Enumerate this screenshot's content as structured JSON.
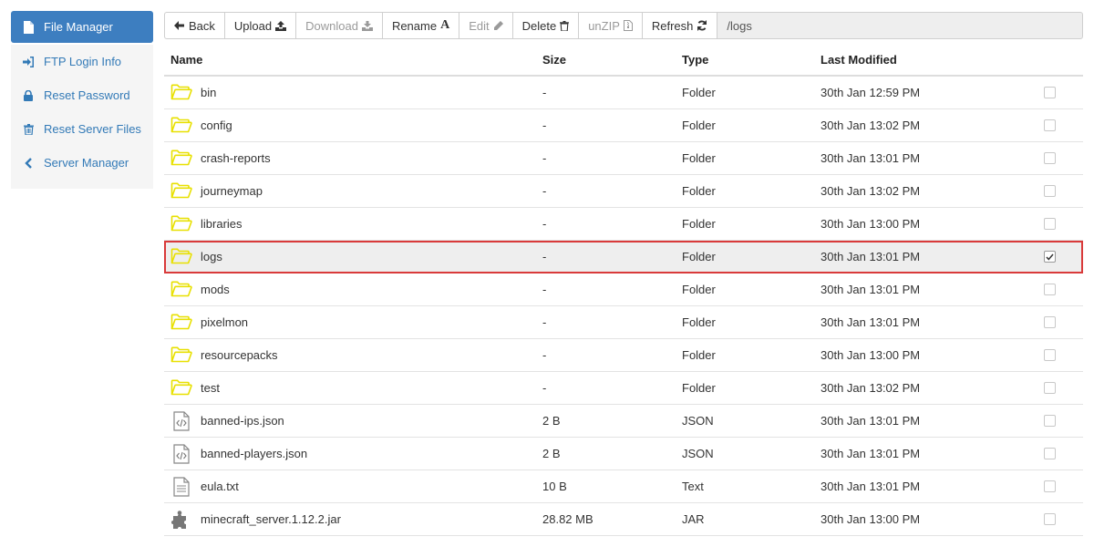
{
  "sidebar": {
    "items": [
      {
        "label": "File Manager",
        "icon": "file-icon",
        "active": true
      },
      {
        "label": "FTP Login Info",
        "icon": "sign-in-icon"
      },
      {
        "label": "Reset Password",
        "icon": "lock-icon"
      },
      {
        "label": "Reset Server Files",
        "icon": "trash-icon"
      },
      {
        "label": "Server Manager",
        "icon": "chevron-left-icon"
      }
    ]
  },
  "toolbar": {
    "back": "Back",
    "upload": "Upload",
    "download": "Download",
    "rename": "Rename",
    "edit": "Edit",
    "delete": "Delete",
    "unzip": "unZIP",
    "refresh": "Refresh",
    "path": "/logs"
  },
  "table": {
    "headers": {
      "name": "Name",
      "size": "Size",
      "type": "Type",
      "modified": "Last Modified"
    },
    "rows": [
      {
        "name": "bin",
        "size": "-",
        "type": "Folder",
        "modified": "30th Jan 12:59 PM",
        "icon": "folder-icon",
        "checked": false
      },
      {
        "name": "config",
        "size": "-",
        "type": "Folder",
        "modified": "30th Jan 13:02 PM",
        "icon": "folder-icon",
        "checked": false
      },
      {
        "name": "crash-reports",
        "size": "-",
        "type": "Folder",
        "modified": "30th Jan 13:01 PM",
        "icon": "folder-icon",
        "checked": false
      },
      {
        "name": "journeymap",
        "size": "-",
        "type": "Folder",
        "modified": "30th Jan 13:02 PM",
        "icon": "folder-icon",
        "checked": false
      },
      {
        "name": "libraries",
        "size": "-",
        "type": "Folder",
        "modified": "30th Jan 13:00 PM",
        "icon": "folder-icon",
        "checked": false
      },
      {
        "name": "logs",
        "size": "-",
        "type": "Folder",
        "modified": "30th Jan 13:01 PM",
        "icon": "folder-icon",
        "checked": true
      },
      {
        "name": "mods",
        "size": "-",
        "type": "Folder",
        "modified": "30th Jan 13:01 PM",
        "icon": "folder-icon",
        "checked": false
      },
      {
        "name": "pixelmon",
        "size": "-",
        "type": "Folder",
        "modified": "30th Jan 13:01 PM",
        "icon": "folder-icon",
        "checked": false
      },
      {
        "name": "resourcepacks",
        "size": "-",
        "type": "Folder",
        "modified": "30th Jan 13:00 PM",
        "icon": "folder-icon",
        "checked": false
      },
      {
        "name": "test",
        "size": "-",
        "type": "Folder",
        "modified": "30th Jan 13:02 PM",
        "icon": "folder-icon",
        "checked": false
      },
      {
        "name": "banned-ips.json",
        "size": "2 B",
        "type": "JSON",
        "modified": "30th Jan 13:01 PM",
        "icon": "code-file-icon",
        "checked": false
      },
      {
        "name": "banned-players.json",
        "size": "2 B",
        "type": "JSON",
        "modified": "30th Jan 13:01 PM",
        "icon": "code-file-icon",
        "checked": false
      },
      {
        "name": "eula.txt",
        "size": "10 B",
        "type": "Text",
        "modified": "30th Jan 13:01 PM",
        "icon": "text-file-icon",
        "checked": false
      },
      {
        "name": "minecraft_server.1.12.2.jar",
        "size": "28.82 MB",
        "type": "JAR",
        "modified": "30th Jan 13:00 PM",
        "icon": "puzzle-icon",
        "checked": false
      }
    ]
  },
  "colors": {
    "accent": "#3d7ec0",
    "folder": "#e8e000",
    "selection_outline": "#d93a3a",
    "link": "#337ab7"
  }
}
